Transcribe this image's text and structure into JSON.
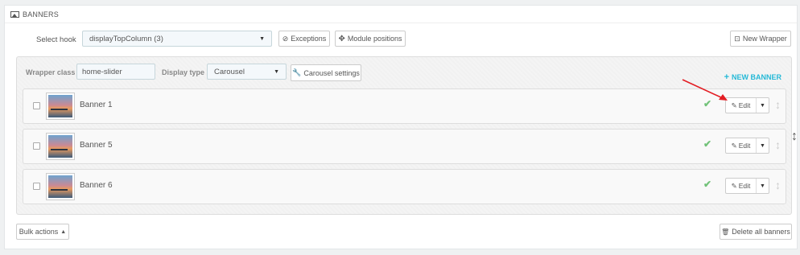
{
  "panel": {
    "title": "BANNERS"
  },
  "hook": {
    "label": "Select hook",
    "selected": "displayTopColumn (3)",
    "exceptions_label": "Exceptions",
    "module_positions_label": "Module positions",
    "new_wrapper_label": "New Wrapper"
  },
  "wrapper": {
    "class_label": "Wrapper class",
    "class_value": "home-slider",
    "display_type_label": "Display type",
    "display_type_value": "Carousel",
    "carousel_settings_label": "Carousel settings",
    "new_banner_label": "NEW BANNER"
  },
  "banners": [
    {
      "title": "Banner 1",
      "edit_label": "Edit",
      "active": true
    },
    {
      "title": "Banner 5",
      "edit_label": "Edit",
      "active": true
    },
    {
      "title": "Banner 6",
      "edit_label": "Edit",
      "active": true
    }
  ],
  "footer": {
    "bulk_actions_label": "Bulk actions",
    "delete_all_label": "Delete all banners"
  },
  "colors": {
    "accent": "#25b9d7",
    "active_check": "#72c279",
    "annotation_arrow": "#e31e24"
  },
  "icons": [
    "picture-icon",
    "ban-icon",
    "arrows-icon",
    "new-wrapper-icon",
    "wrench-icon",
    "plus-icon",
    "pencil-icon",
    "check-icon",
    "vertical-arrows-icon",
    "trash-icon",
    "caret-up-icon",
    "caret-down-icon"
  ]
}
